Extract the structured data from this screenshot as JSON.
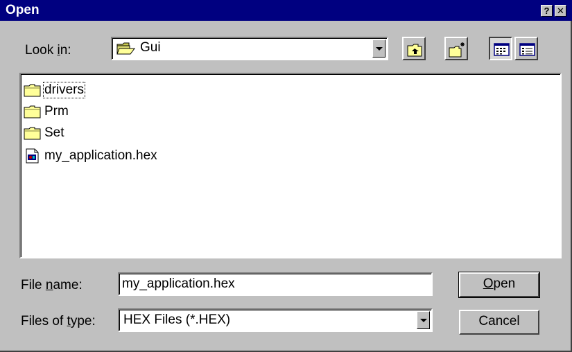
{
  "window": {
    "title": "Open",
    "help_glyph": "?",
    "close_glyph": "✕"
  },
  "look_in": {
    "label_pre": "Look ",
    "label_ul": "i",
    "label_post": "n:",
    "value": "Gui",
    "icon": "folder-open-icon"
  },
  "toolbar": {
    "buttons": [
      {
        "name": "up-one-level-button",
        "icon": "folder-up-icon"
      },
      {
        "name": "create-new-folder-button",
        "icon": "new-folder-icon"
      },
      {
        "name": "list-view-button",
        "icon": "list-view-icon",
        "pressed": true
      },
      {
        "name": "details-view-button",
        "icon": "details-view-icon"
      }
    ]
  },
  "files": [
    {
      "label": "drivers",
      "icon": "folder-icon",
      "focused": true
    },
    {
      "label": "Prm",
      "icon": "folder-icon"
    },
    {
      "label": "Set",
      "icon": "folder-icon"
    },
    {
      "label": "my_application.hex",
      "icon": "hex-file-icon"
    }
  ],
  "file_name": {
    "label_pre": "File ",
    "label_ul": "n",
    "label_post": "ame:",
    "value": "my_application.hex"
  },
  "file_type": {
    "label_pre": "Files of ",
    "label_ul": "t",
    "label_post": "ype:",
    "value": "HEX Files (*.HEX)"
  },
  "buttons": {
    "open_ul": "O",
    "open_rest": "pen",
    "cancel": "Cancel"
  },
  "colors": {
    "titlebar": "#000080",
    "face": "#c0c0c0",
    "folder": "#ffff99"
  }
}
